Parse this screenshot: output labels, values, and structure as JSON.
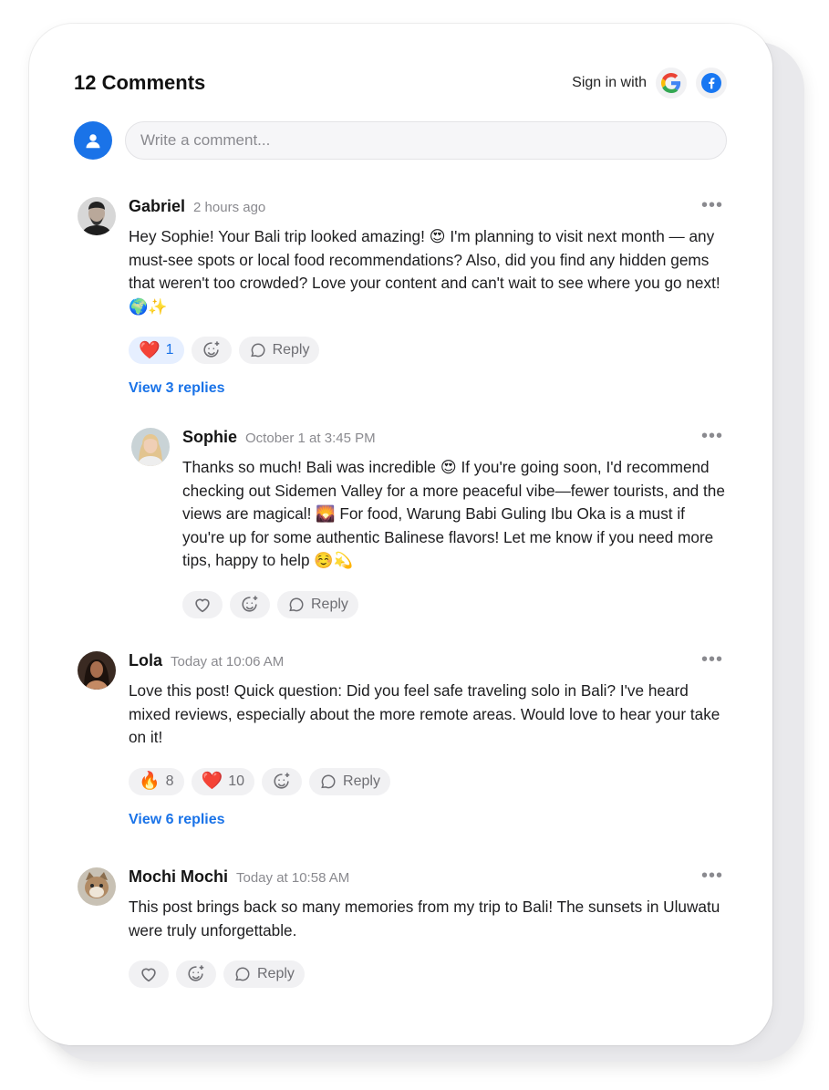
{
  "header": {
    "title": "12 Comments",
    "signin_label": "Sign in with"
  },
  "composer": {
    "placeholder": "Write a comment..."
  },
  "colors": {
    "accent": "#1a73e8",
    "pill_bg": "#f1f1f3"
  },
  "comments": [
    {
      "name": "Gabriel",
      "time": "2 hours ago",
      "text": "Hey Sophie! Your Bali trip looked amazing! 😍 I'm planning to visit next month — any must-see spots or local food recommendations? Also, did you find any hidden gems that weren't too crowded? Love your content and can't wait to see where you go next! 🌍✨",
      "reaction_heart_emoji": "❤️",
      "reaction_heart_count": "1",
      "reply_label": "Reply",
      "view_replies": "View 3 replies"
    },
    {
      "name": "Sophie",
      "time": "October 1 at 3:45 PM",
      "text": "Thanks so much! Bali was incredible 😍 If you're going soon, I'd recommend checking out Sidemen Valley for a more peaceful vibe—fewer tourists, and the views are magical! 🌄 For food, Warung Babi Guling Ibu Oka is a must if you're up for some authentic Balinese flavors! Let me know if you need more tips, happy to help ☺️💫",
      "reply_label": "Reply"
    },
    {
      "name": "Lola",
      "time": "Today at 10:06 AM",
      "text": "Love this post! Quick question: Did you feel safe traveling solo in Bali? I've heard mixed reviews, especially about the more remote areas. Would love to hear your take on it!",
      "reaction_fire_emoji": "🔥",
      "reaction_fire_count": "8",
      "reaction_heart_emoji": "❤️",
      "reaction_heart_count": "10",
      "reply_label": "Reply",
      "view_replies": "View 6 replies"
    },
    {
      "name": "Mochi Mochi",
      "time": "Today at 10:58 AM",
      "text": "This post brings back so many memories from my trip to Bali! The sunsets in Uluwatu were truly unforgettable.",
      "reply_label": "Reply"
    }
  ]
}
